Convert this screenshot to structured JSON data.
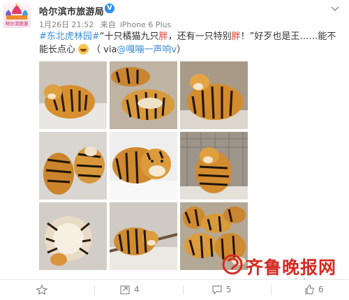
{
  "account": {
    "name": "哈尔滨市旅游局",
    "verified_mark": "V",
    "avatar_icon": "harbin-tourism-logo",
    "avatar_caption": "哈尔滨旅游"
  },
  "post": {
    "date": "1月26日 21:52",
    "source_prefix": "来自",
    "source": "iPhone 6 Plus",
    "hashtag": "#东北虎林园#",
    "text_quote_open": "“十只橘猫九只",
    "text_fat1": "胖",
    "text_mid": "，还有一只特别",
    "text_fat2": "胖",
    "text_quote_close": "！”好歹也是王……能不能长点心",
    "via_open": "（ via",
    "via_user": "@嘎嘣一声响v",
    "via_close": "）"
  },
  "images": [
    {
      "name": "fat-tiger-lying-on-snow"
    },
    {
      "name": "tigers-lying-in-group"
    },
    {
      "name": "chubby-tiger-standing"
    },
    {
      "name": "tigers-on-snow-ground"
    },
    {
      "name": "tiger-face-closeup"
    },
    {
      "name": "tiger-sitting-by-fence"
    },
    {
      "name": "tiger-sleeping-on-back"
    },
    {
      "name": "tiger-crouching-by-branch"
    },
    {
      "name": "many-tigers-crowd"
    }
  ],
  "actions": {
    "repost_count": "4",
    "comment_count": "5",
    "like_count": "6"
  },
  "watermark": {
    "name": "齐鲁晚报网",
    "url": "www.qlwb.com.cn"
  },
  "colors": {
    "link": "#3c8ed6",
    "highlight": "#e0342c",
    "verified": "#2f8ff0",
    "watermark": "#d42c24"
  }
}
